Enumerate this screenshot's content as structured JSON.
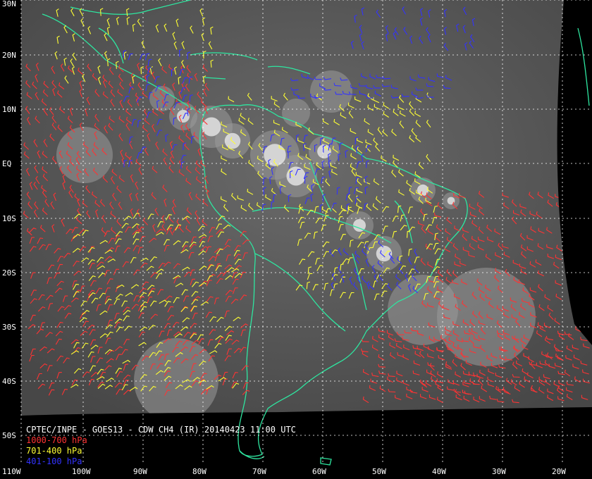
{
  "map": {
    "title": "CPTEC/INPE - GOES13 - CDW CH4 (IR) 20140423 11:00 UTC",
    "legend": [
      {
        "label": "1000-700 hPa",
        "color": "#ff3333"
      },
      {
        "label": "701-400 hPa",
        "color": "#ffff33"
      },
      {
        "label": "401-100 hPa",
        "color": "#3333ff"
      }
    ],
    "lat_labels": [
      "30N",
      "20N",
      "10N",
      "EQ",
      "10S",
      "20S",
      "30S",
      "40S",
      "50S"
    ],
    "lon_labels": [
      "110W",
      "100W",
      "90W",
      "80W",
      "70W",
      "60W",
      "50W",
      "40W",
      "30W",
      "20W"
    ],
    "colors": {
      "background": "#000000",
      "coastline": "#2ee6a0",
      "grid": "#ffffff",
      "cloud_base": "#5a5a5a"
    }
  }
}
